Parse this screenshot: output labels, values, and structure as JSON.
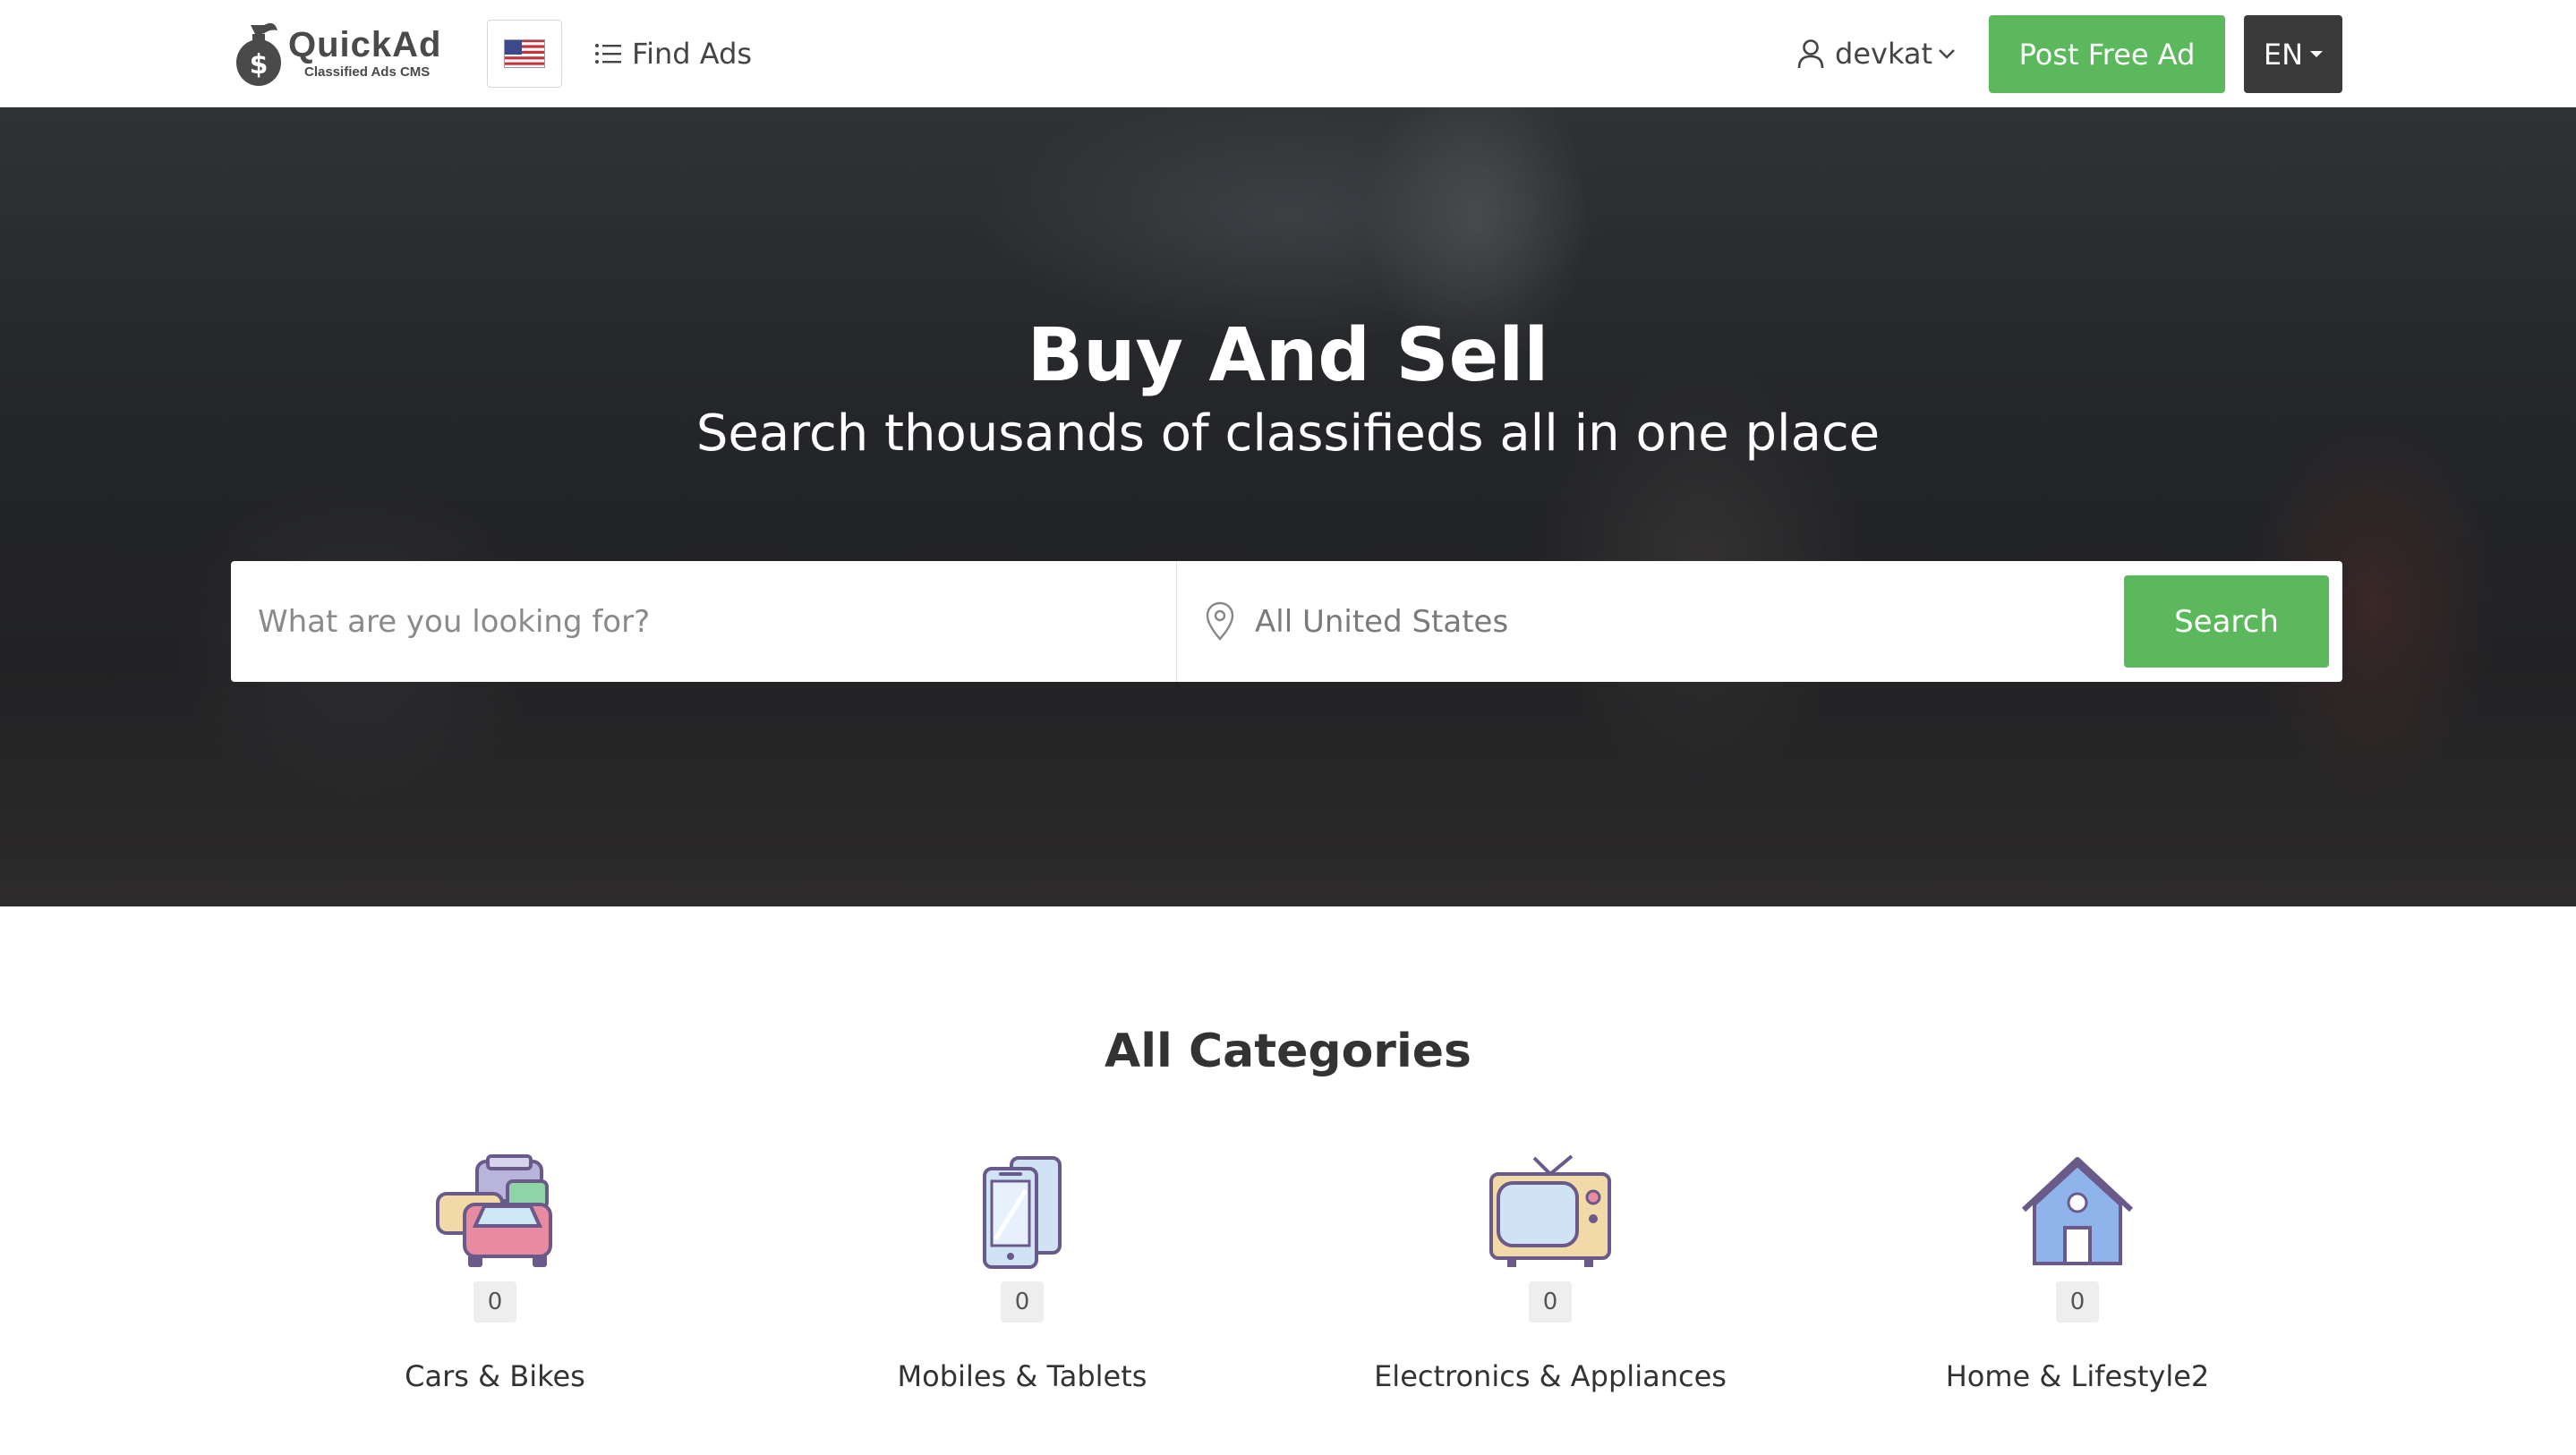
{
  "header": {
    "logo_title": "QuickAd",
    "logo_subtitle": "Classified Ads CMS",
    "find_ads_label": "Find Ads",
    "username": "devkat",
    "post_ad_label": "Post Free Ad",
    "language_label": "EN"
  },
  "hero": {
    "title": "Buy And Sell",
    "subtitle": "Search thousands of classifieds all in one place",
    "search_placeholder": "What are you looking for?",
    "location_placeholder": "All United States",
    "search_button": "Search"
  },
  "categories": {
    "heading": "All Categories",
    "items": [
      {
        "name": "Cars & Bikes",
        "count": "0",
        "icon": "cars-icon"
      },
      {
        "name": "Mobiles & Tablets",
        "count": "0",
        "icon": "mobiles-icon"
      },
      {
        "name": "Electronics & Appliances",
        "count": "0",
        "icon": "tv-icon"
      },
      {
        "name": "Home & Lifestyle2",
        "count": "0",
        "icon": "house-icon"
      }
    ]
  },
  "colors": {
    "accent_green": "#5cb85c",
    "dark_button": "#3a3a3a"
  }
}
